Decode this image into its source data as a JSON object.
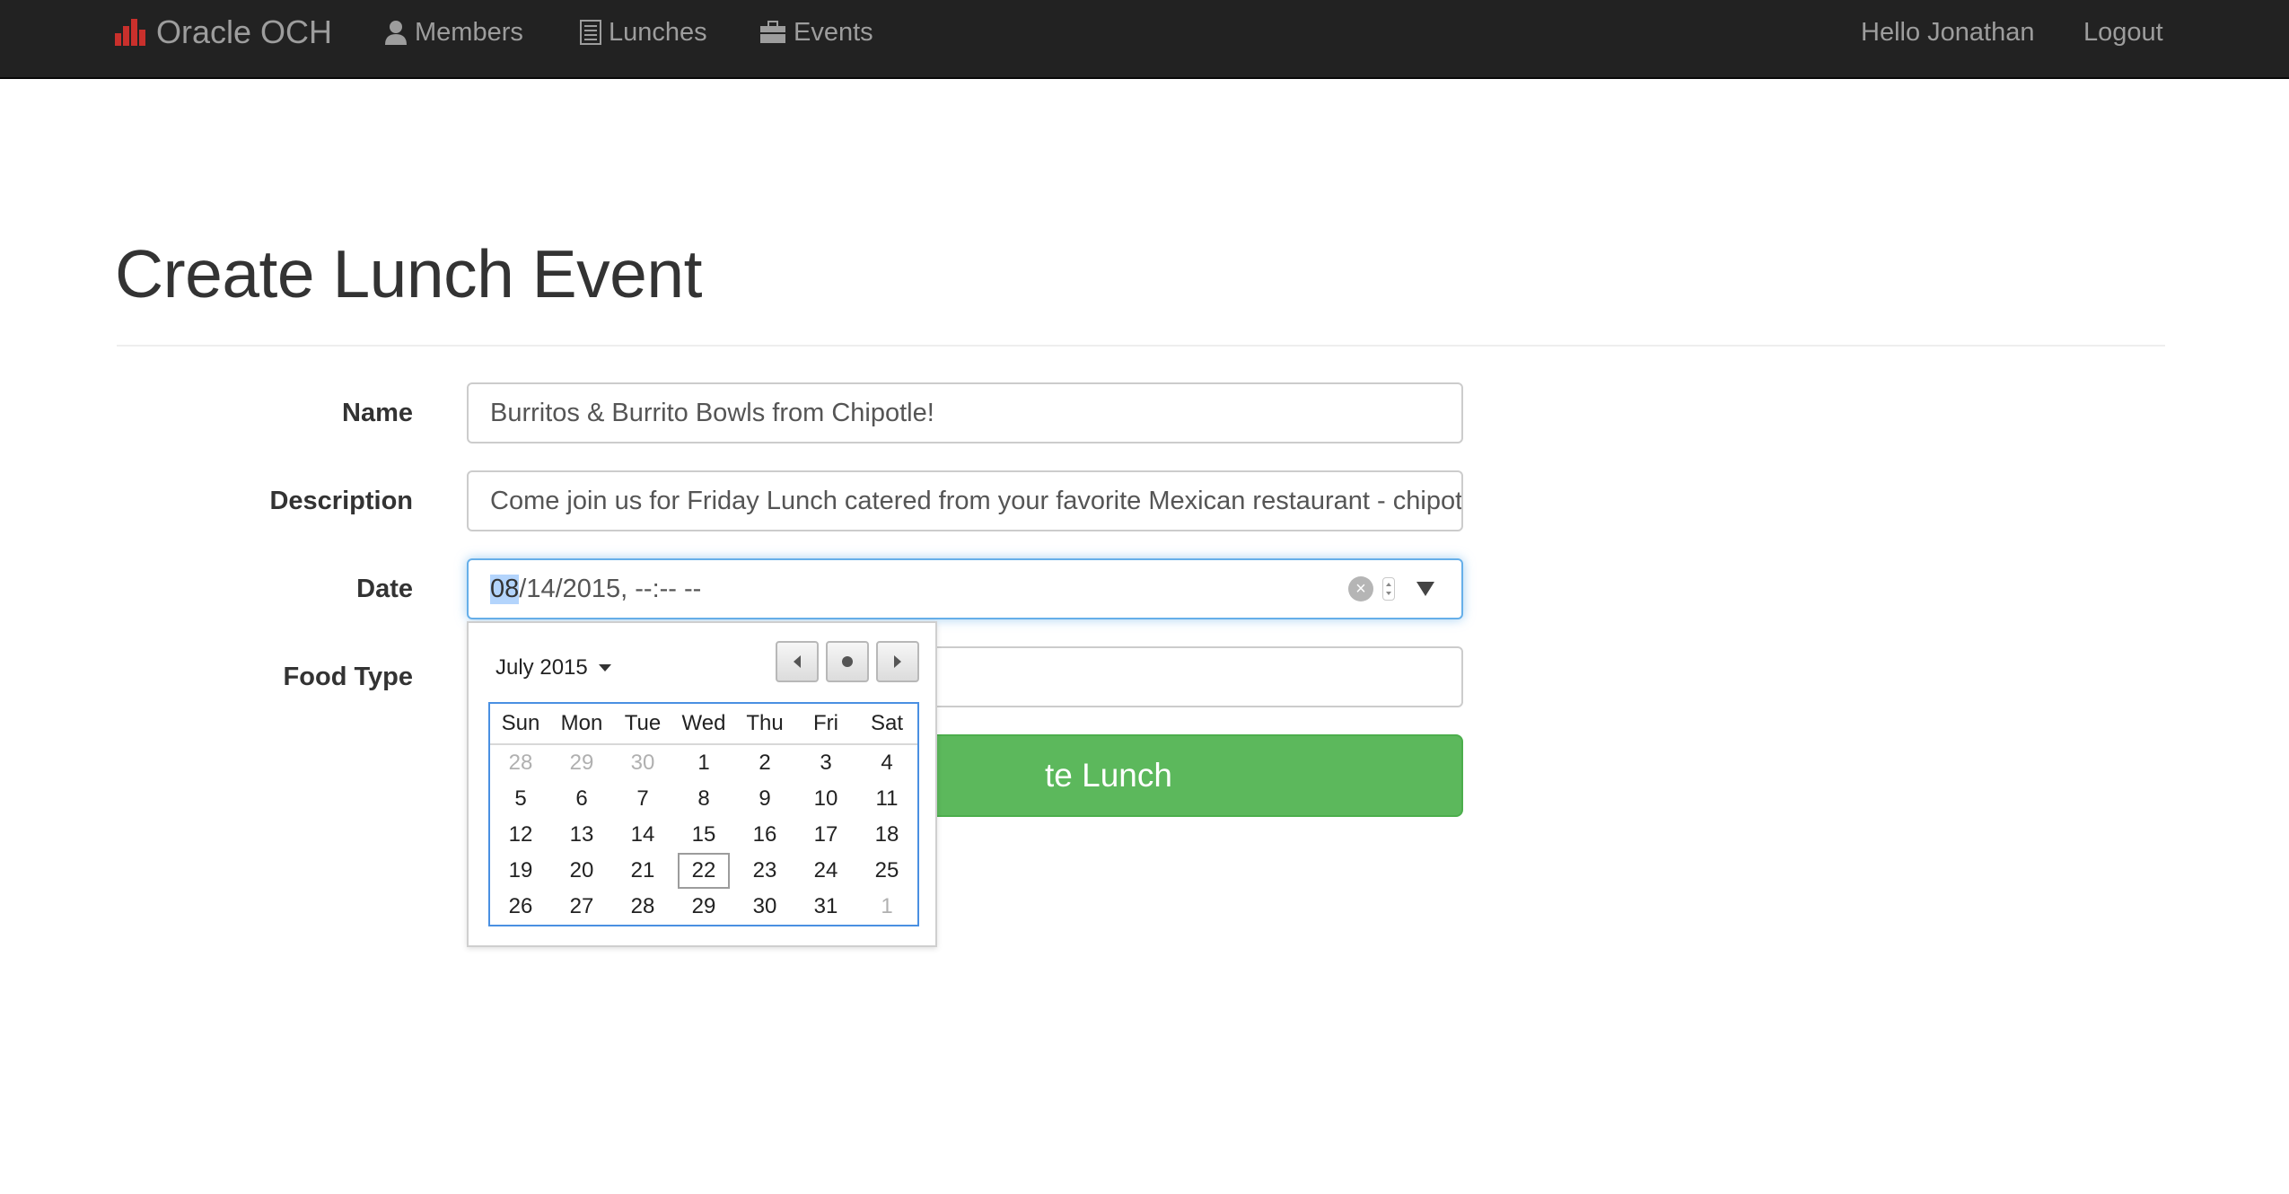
{
  "navbar": {
    "brand": "Oracle OCH",
    "members": "Members",
    "lunches": "Lunches",
    "events": "Events",
    "hello": "Hello Jonathan",
    "logout": "Logout"
  },
  "page": {
    "title": "Create Lunch Event"
  },
  "form": {
    "name_label": "Name",
    "name_value": "Burritos & Burrito Bowls from Chipotle!",
    "description_label": "Description",
    "description_value": "Come join us for Friday Lunch catered from your favorite Mexican restaurant - chipot",
    "date_label": "Date",
    "date_month": "08",
    "date_rest": "/14/2015, --:-- --",
    "food_type_label": "Food Type",
    "food_type_value": "",
    "submit_visible": "te Lunch"
  },
  "calendar": {
    "month_label": "July 2015",
    "weekdays": [
      "Sun",
      "Mon",
      "Tue",
      "Wed",
      "Thu",
      "Fri",
      "Sat"
    ],
    "days": [
      {
        "d": "28",
        "muted": true
      },
      {
        "d": "29",
        "muted": true
      },
      {
        "d": "30",
        "muted": true
      },
      {
        "d": "1"
      },
      {
        "d": "2"
      },
      {
        "d": "3"
      },
      {
        "d": "4"
      },
      {
        "d": "5"
      },
      {
        "d": "6"
      },
      {
        "d": "7"
      },
      {
        "d": "8"
      },
      {
        "d": "9"
      },
      {
        "d": "10"
      },
      {
        "d": "11"
      },
      {
        "d": "12"
      },
      {
        "d": "13"
      },
      {
        "d": "14"
      },
      {
        "d": "15"
      },
      {
        "d": "16"
      },
      {
        "d": "17"
      },
      {
        "d": "18"
      },
      {
        "d": "19"
      },
      {
        "d": "20"
      },
      {
        "d": "21"
      },
      {
        "d": "22",
        "today": true
      },
      {
        "d": "23"
      },
      {
        "d": "24"
      },
      {
        "d": "25"
      },
      {
        "d": "26"
      },
      {
        "d": "27"
      },
      {
        "d": "28"
      },
      {
        "d": "29"
      },
      {
        "d": "30"
      },
      {
        "d": "31"
      },
      {
        "d": "1",
        "muted": true
      }
    ]
  },
  "colors": {
    "navbar_bg": "#222222",
    "brand_logo": "#c9302c",
    "submit_bg": "#5cb85c",
    "focus_border": "#66afe9"
  }
}
